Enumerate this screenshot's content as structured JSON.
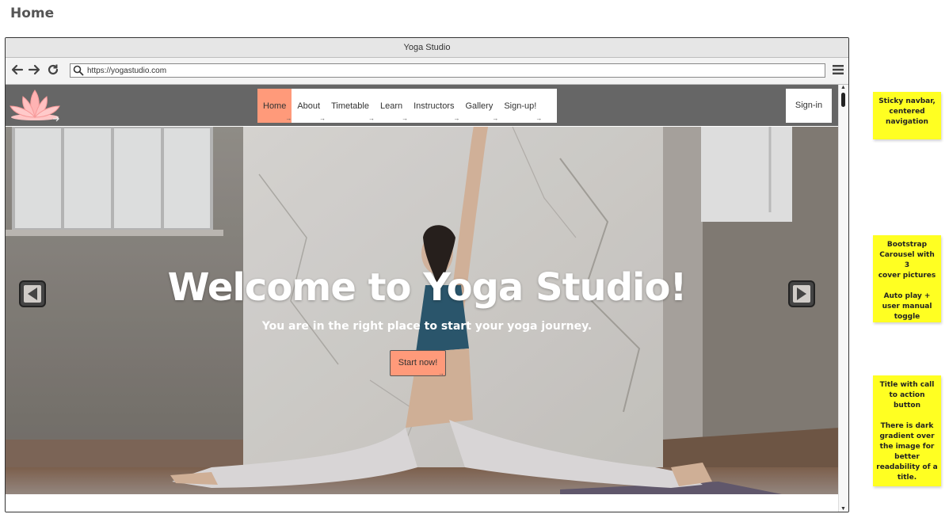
{
  "page": {
    "heading": "Home"
  },
  "browser": {
    "window_title": "Yoga Studio",
    "url": "https://yogastudio.com"
  },
  "site": {
    "nav_items": [
      "Home",
      "About",
      "Timetable",
      "Learn",
      "Instructors",
      "Gallery",
      "Sign-up!"
    ],
    "active_nav": "Home",
    "signin_label": "Sign-in",
    "hero_title": "Welcome to Yoga Studio!",
    "hero_subtitle": "You are in the right place to start your yoga journey.",
    "cta_label": "Start now!"
  },
  "notes": [
    {
      "text": "Sticky navbar,\ncentered\nnavigation"
    },
    {
      "text": "Bootstrap\nCarousel with 3\ncover pictures\n\nAuto play +\nuser manual\ntoggle"
    },
    {
      "text": "Title with call\nto action\nbutton\n\nThere is dark\ngradient over\nthe image for\nbetter\nreadability of a\ntitle."
    }
  ],
  "colors": {
    "accent": "#ff9a7a",
    "navbar": "#666666",
    "sticky_note": "#ffff22"
  },
  "icons": [
    "back-arrow-icon",
    "forward-arrow-icon",
    "reload-icon",
    "search-icon",
    "hamburger-menu-icon",
    "lotus-logo-icon",
    "carousel-prev-icon",
    "carousel-next-icon"
  ]
}
